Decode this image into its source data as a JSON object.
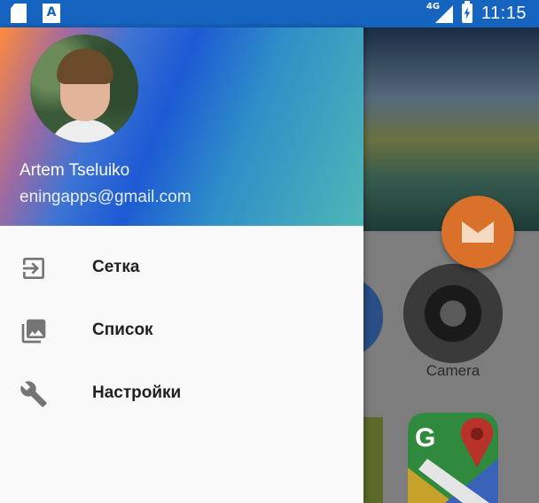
{
  "status_bar": {
    "time": "11:15",
    "network": "4G",
    "icons": [
      "sd-card-icon",
      "text-a-icon",
      "signal-icon",
      "battery-charging-icon"
    ]
  },
  "background_app": {
    "camera_label": "Camera",
    "fab_icon": "email-icon"
  },
  "drawer": {
    "user_name": "Artem Tseluiko",
    "user_email": "eningapps@gmail.com",
    "items": [
      {
        "label": "Сетка",
        "icon": "exit-to-app-icon"
      },
      {
        "label": "Список",
        "icon": "photo-library-icon"
      },
      {
        "label": "Настройки",
        "icon": "wrench-icon"
      }
    ]
  },
  "colors": {
    "status_bar": "#1565c0",
    "fab": "#d9712b",
    "drawer_bg": "#f9f9f9",
    "icon_gray": "#757575"
  }
}
